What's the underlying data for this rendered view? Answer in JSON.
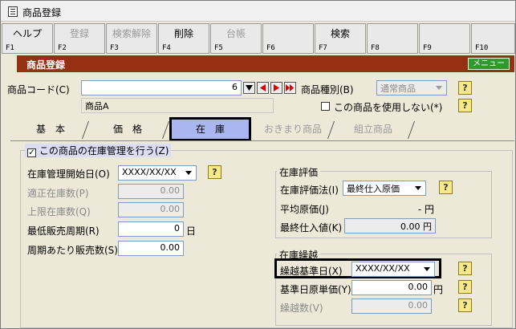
{
  "window": {
    "title": "商品登録"
  },
  "fkeys": [
    {
      "label": "ヘルプ",
      "fn": "F1",
      "enabled": true
    },
    {
      "label": "登録",
      "fn": "F2",
      "enabled": false
    },
    {
      "label": "検索解除",
      "fn": "F3",
      "enabled": false
    },
    {
      "label": "削除",
      "fn": "F4",
      "enabled": true
    },
    {
      "label": "台帳",
      "fn": "F5",
      "enabled": false
    },
    {
      "label": "",
      "fn": "F6",
      "enabled": false
    },
    {
      "label": "検索",
      "fn": "F7",
      "enabled": true
    },
    {
      "label": "",
      "fn": "F8",
      "enabled": false
    },
    {
      "label": "",
      "fn": "F9",
      "enabled": false
    },
    {
      "label": "",
      "fn": "F10",
      "enabled": false
    }
  ],
  "header": {
    "title": "商品登録",
    "menu_button": "メニュー"
  },
  "product": {
    "code_label": "商品コード(C)",
    "code_value": "6",
    "name_value": "商品A",
    "type_label": "商品種別(B)",
    "type_value": "通常商品",
    "unused_label": "この商品を使用しない(*)"
  },
  "tabs": [
    {
      "label": "基　本",
      "active": false,
      "enabled": true
    },
    {
      "label": "価　格",
      "active": false,
      "enabled": true
    },
    {
      "label": "在　庫",
      "active": true,
      "enabled": true
    },
    {
      "label": "おきまり商品",
      "active": false,
      "enabled": false
    },
    {
      "label": "組立商品",
      "active": false,
      "enabled": false
    }
  ],
  "stock": {
    "manage_label": "この商品の在庫管理を行う(Z)",
    "manage_checked": true,
    "start_label": "在庫管理開始日(O)",
    "start_value": "XXXX/XX/XX",
    "proper_label": "適正在庫数(P)",
    "proper_value": "0.00",
    "upper_label": "上限在庫数(Q)",
    "upper_value": "0.00",
    "min_period_label": "最低販売周期(R)",
    "min_period_value": "0",
    "min_period_unit": "日",
    "per_period_label": "周期あたり販売数(S)",
    "per_period_value": "0.00"
  },
  "valuation": {
    "group_label": "在庫評価",
    "method_label": "在庫評価法(I)",
    "method_value": "最終仕入原価",
    "avg_label": "平均原価(J)",
    "avg_value": "- 円",
    "last_label": "最終仕入値(K)",
    "last_value": "0.00 円"
  },
  "carryover": {
    "group_label": "在庫繰越",
    "date_label": "繰越基準日(X)",
    "date_value": "XXXX/XX/XX",
    "price_label": "基準日原単価(Y)",
    "price_value": "0.00",
    "price_unit": "円",
    "qty_label": "繰越数(V)",
    "qty_value": "0.00"
  }
}
